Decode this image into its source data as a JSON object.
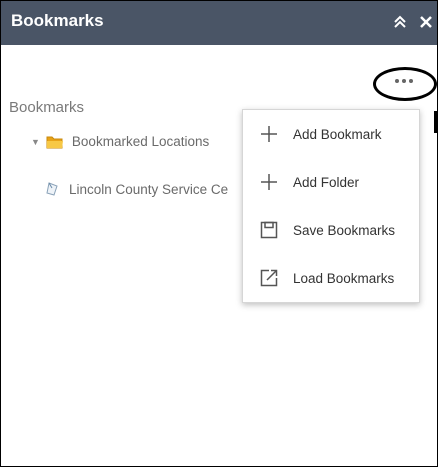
{
  "panel": {
    "title": "Bookmarks",
    "header_bg": "#4a5566",
    "header_icons": [
      "collapse-icon",
      "close-icon"
    ]
  },
  "more_button": {
    "icon": "more-options-icon"
  },
  "tree": {
    "section_label": "Bookmarks",
    "folder": {
      "label": "Bookmarked Locations",
      "icon": "folder-icon",
      "expanded": true
    },
    "items": [
      {
        "label": "Lincoln County Service Ce",
        "icon": "bookmark-icon"
      }
    ]
  },
  "menu": {
    "items": [
      {
        "label": "Add Bookmark",
        "icon": "plus-icon"
      },
      {
        "label": "Add Folder",
        "icon": "plus-icon"
      },
      {
        "label": "Save Bookmarks",
        "icon": "save-icon"
      },
      {
        "label": "Load Bookmarks",
        "icon": "load-icon"
      }
    ]
  }
}
